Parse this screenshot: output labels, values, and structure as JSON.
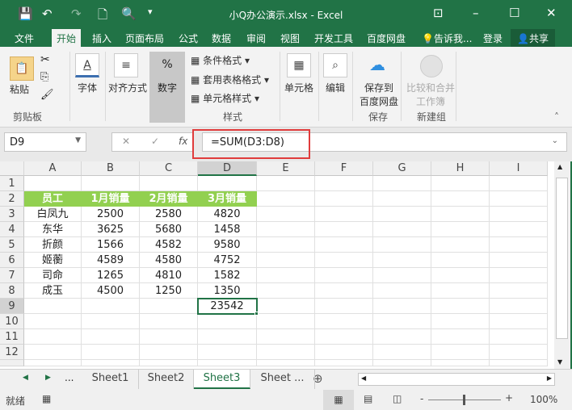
{
  "window": {
    "title": "小Q办公演示.xlsx - Excel"
  },
  "ribbon_tabs": [
    "文件",
    "开始",
    "插入",
    "页面布局",
    "公式",
    "数据",
    "审阅",
    "视图",
    "开发工具",
    "百度网盘",
    "告诉我...",
    "登录",
    "共享"
  ],
  "ribbon": {
    "paste": "粘贴",
    "clipboard_group": "剪贴板",
    "font": "字体",
    "align": "对齐方式",
    "number": "数字",
    "cond_format": "条件格式",
    "table_format": "套用表格格式",
    "cell_style": "单元格样式",
    "styles_group": "样式",
    "cells": "单元格",
    "edit": "编辑",
    "save_baidu": "保存到",
    "save_baidu2": "百度网盘",
    "save_group": "保存",
    "compare": "比较和合并",
    "compare2": "工作簿",
    "new_group": "新建组"
  },
  "formula_bar": {
    "name_box": "D9",
    "formula": "=SUM(D3:D8)"
  },
  "columns": [
    "A",
    "B",
    "C",
    "D",
    "E",
    "F",
    "G",
    "H",
    "I"
  ],
  "rows": [
    "1",
    "2",
    "3",
    "4",
    "5",
    "6",
    "7",
    "8",
    "9",
    "10",
    "11",
    "12"
  ],
  "table": {
    "headers": [
      "员工",
      "1月销量",
      "2月销量",
      "3月销量"
    ],
    "data": [
      [
        "白凤九",
        "2500",
        "2580",
        "4820"
      ],
      [
        "东华",
        "3625",
        "5680",
        "1458"
      ],
      [
        "折颜",
        "1566",
        "4582",
        "9580"
      ],
      [
        "姬蘅",
        "4589",
        "4580",
        "4752"
      ],
      [
        "司命",
        "1265",
        "4810",
        "1582"
      ],
      [
        "成玉",
        "4500",
        "1250",
        "1350"
      ]
    ],
    "total": "23542"
  },
  "sheets": [
    "Sheet1",
    "Sheet2",
    "Sheet3",
    "Sheet ..."
  ],
  "active_sheet": "Sheet3",
  "status": {
    "ready": "就绪",
    "zoom": "100%"
  },
  "colors": {
    "accent": "#217346",
    "header_fill": "#92d050",
    "highlight": "#e03c3c"
  }
}
